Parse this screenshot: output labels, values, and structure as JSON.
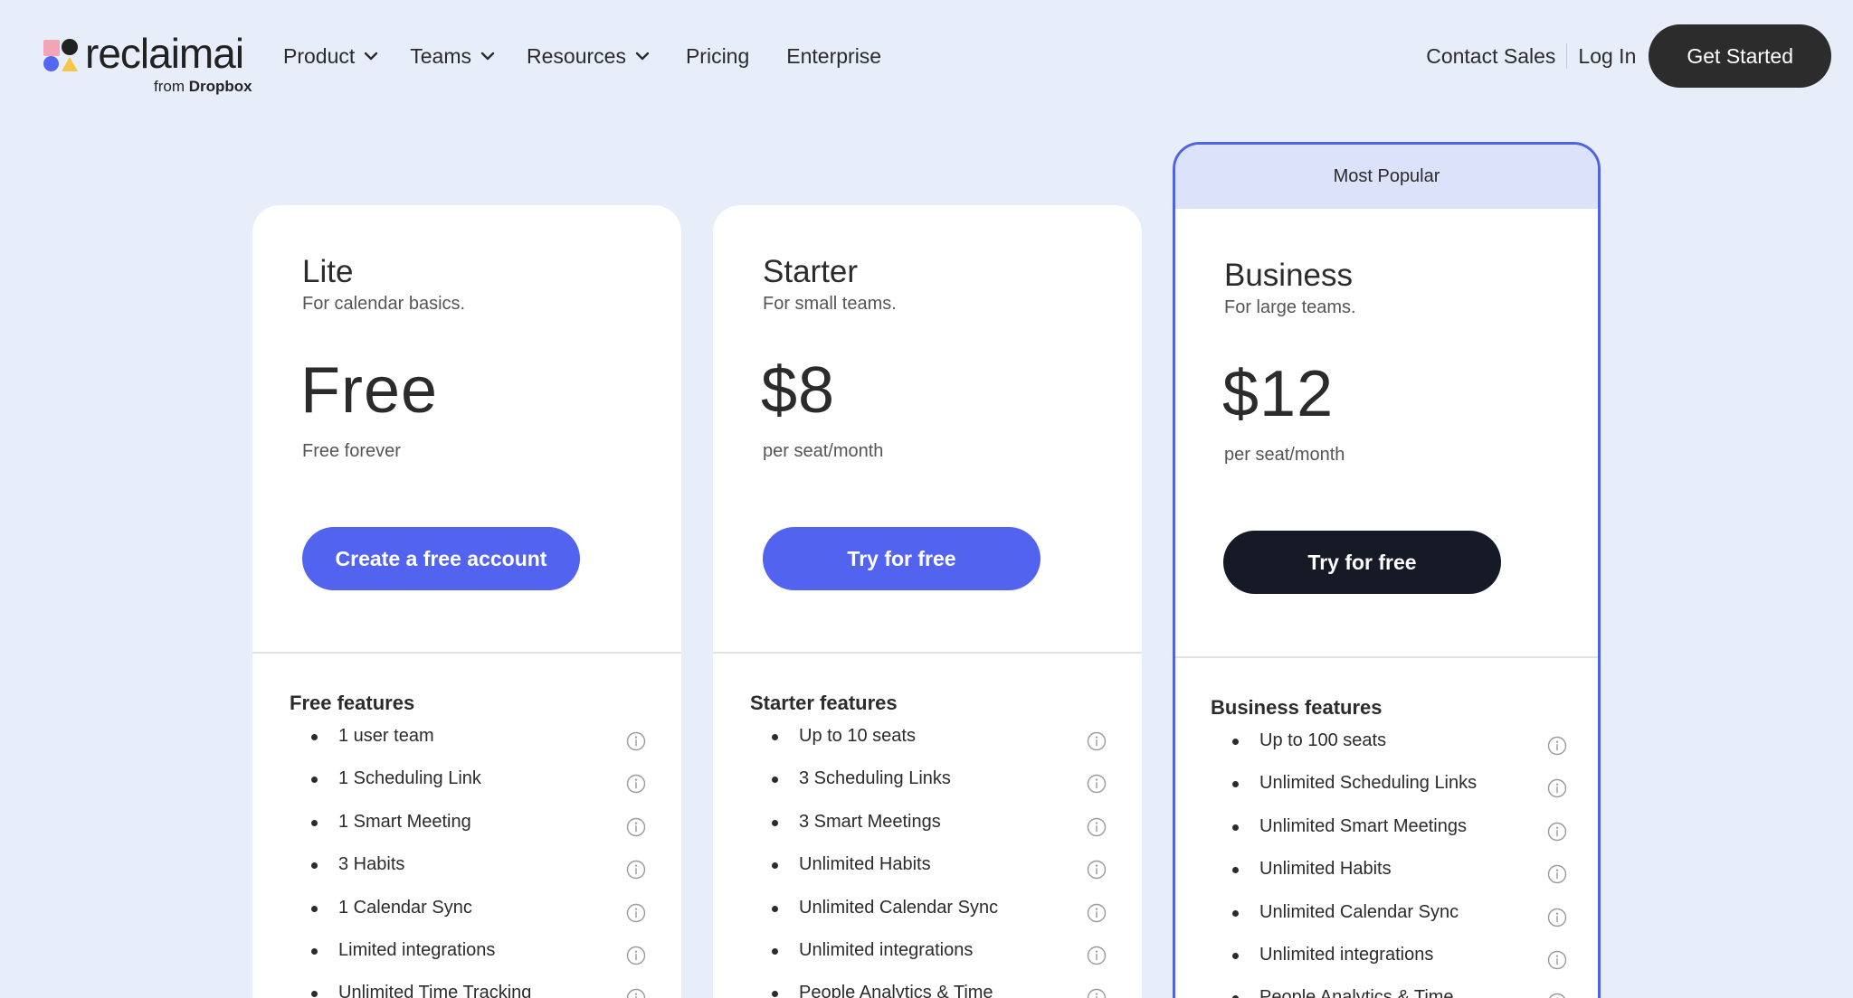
{
  "brand": {
    "name": "reclaimai",
    "sub_prefix": "from",
    "sub_brand": "Dropbox"
  },
  "nav": {
    "links": [
      {
        "label": "Product",
        "dropdown": true
      },
      {
        "label": "Teams",
        "dropdown": true
      },
      {
        "label": "Resources",
        "dropdown": true
      },
      {
        "label": "Pricing",
        "dropdown": false
      },
      {
        "label": "Enterprise",
        "dropdown": false
      }
    ],
    "contact_sales": "Contact Sales",
    "log_in": "Log In",
    "get_started": "Get Started"
  },
  "plans": {
    "lite": {
      "name": "Lite",
      "desc": "For calendar basics.",
      "price": "Free",
      "price_sub": "Free forever",
      "cta": "Create a free account",
      "features_title": "Free features",
      "features": [
        "1 user team",
        "1 Scheduling Link",
        "1 Smart Meeting",
        "3 Habits",
        "1 Calendar Sync",
        "Limited integrations",
        "Unlimited Time Tracking"
      ]
    },
    "starter": {
      "name": "Starter",
      "desc": "For small teams.",
      "price": "$8",
      "price_sub": "per seat/month",
      "cta": "Try for free",
      "features_title": "Starter features",
      "features": [
        "Up to 10 seats",
        "3 Scheduling Links",
        "3 Smart Meetings",
        "Unlimited Habits",
        "Unlimited Calendar Sync",
        "Unlimited integrations",
        "People Analytics & Time"
      ]
    },
    "business": {
      "badge": "Most Popular",
      "name": "Business",
      "desc": "For large teams.",
      "price": "$12",
      "price_sub": "per seat/month",
      "cta": "Try for free",
      "features_title": "Business features",
      "features": [
        "Up to 100 seats",
        "Unlimited Scheduling Links",
        "Unlimited Smart Meetings",
        "Unlimited Habits",
        "Unlimited Calendar Sync",
        "Unlimited integrations",
        "People Analytics & Time"
      ]
    }
  },
  "colors": {
    "background": "#e8edfa",
    "primary_button": "#5263f0",
    "dark_button": "#151a26",
    "popular_banner": "#dde2fb",
    "popular_border": "#5063e6"
  },
  "icons": {
    "info": "info-circle-icon",
    "dropdown": "chevron-down-icon"
  }
}
